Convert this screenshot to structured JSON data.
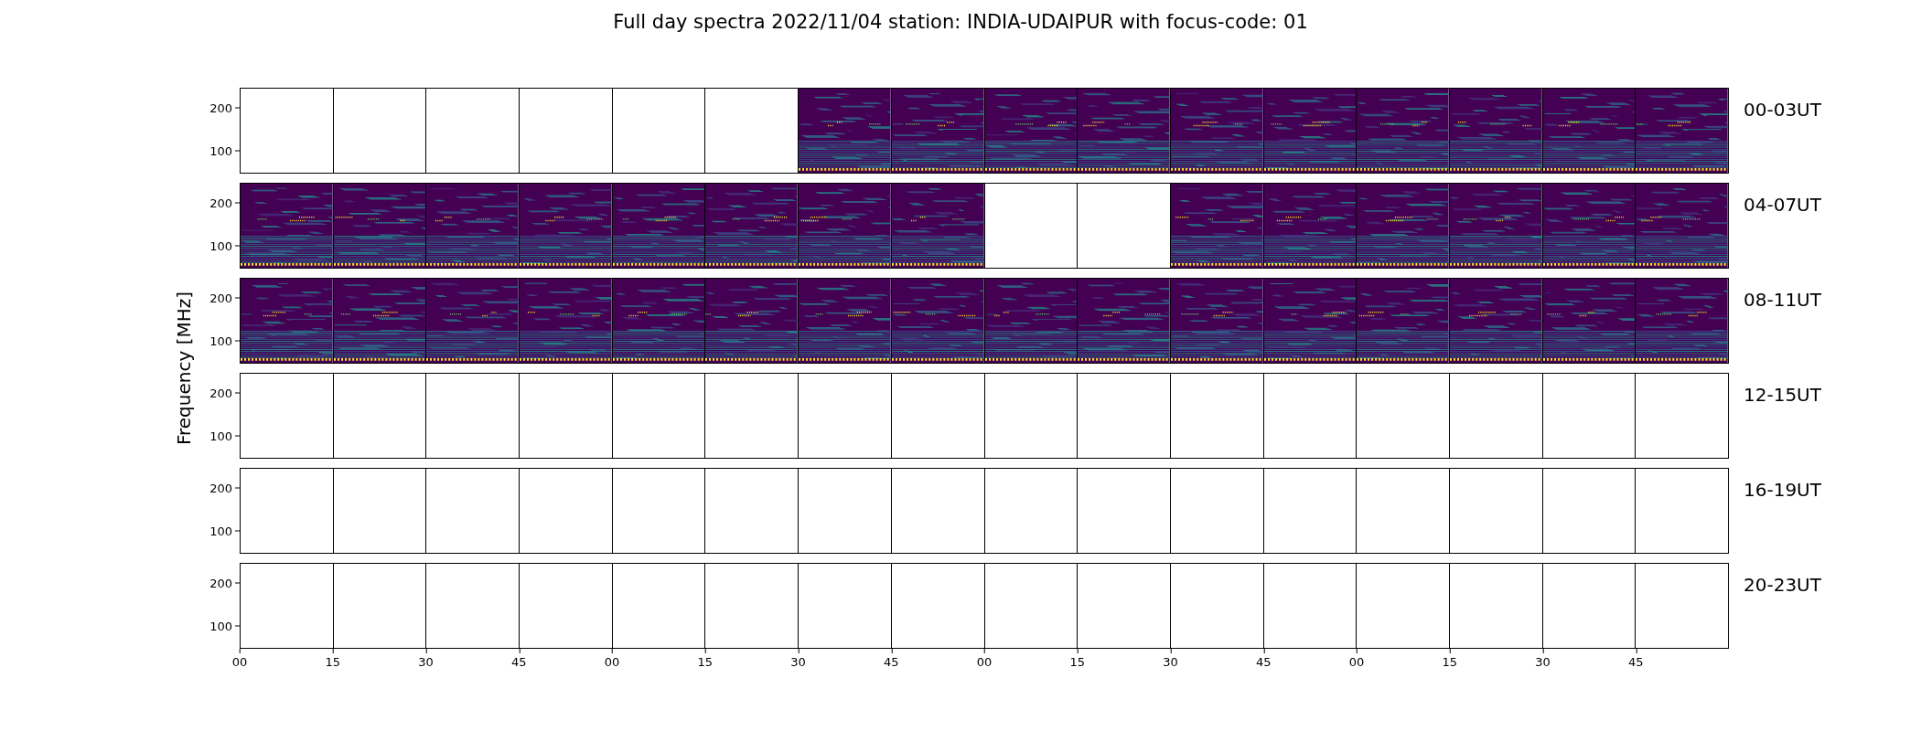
{
  "title": "Full day spectra 2022/11/04 station: INDIA-UDAIPUR with focus-code: 01",
  "ylabel": "Frequency [MHz]",
  "rows": [
    {
      "label": "00-03UT",
      "yticks": [
        "200",
        "100"
      ],
      "panels": [
        {
          "kind": "empty"
        },
        {
          "kind": "empty"
        },
        {
          "kind": "empty"
        },
        {
          "kind": "empty"
        },
        {
          "kind": "empty"
        },
        {
          "kind": "empty"
        },
        {
          "kind": "spectrum"
        },
        {
          "kind": "spectrum"
        },
        {
          "kind": "spectrum"
        },
        {
          "kind": "spectrum"
        },
        {
          "kind": "spectrum"
        },
        {
          "kind": "spectrum"
        },
        {
          "kind": "spectrum"
        },
        {
          "kind": "spectrum"
        },
        {
          "kind": "spectrum"
        },
        {
          "kind": "spectrum"
        }
      ]
    },
    {
      "label": "04-07UT",
      "yticks": [
        "200",
        "100"
      ],
      "panels": [
        {
          "kind": "spectrum"
        },
        {
          "kind": "spectrum"
        },
        {
          "kind": "spectrum"
        },
        {
          "kind": "spectrum"
        },
        {
          "kind": "spectrum"
        },
        {
          "kind": "spectrum"
        },
        {
          "kind": "spectrum"
        },
        {
          "kind": "spectrum"
        },
        {
          "kind": "empty"
        },
        {
          "kind": "empty"
        },
        {
          "kind": "spectrum"
        },
        {
          "kind": "spectrum"
        },
        {
          "kind": "spectrum"
        },
        {
          "kind": "spectrum"
        },
        {
          "kind": "spectrum"
        },
        {
          "kind": "spectrum"
        }
      ]
    },
    {
      "label": "08-11UT",
      "yticks": [
        "200",
        "100"
      ],
      "panels": [
        {
          "kind": "spectrum"
        },
        {
          "kind": "spectrum"
        },
        {
          "kind": "spectrum"
        },
        {
          "kind": "spectrum"
        },
        {
          "kind": "spectrum"
        },
        {
          "kind": "spectrum"
        },
        {
          "kind": "spectrum"
        },
        {
          "kind": "spectrum"
        },
        {
          "kind": "spectrum"
        },
        {
          "kind": "spectrum"
        },
        {
          "kind": "spectrum"
        },
        {
          "kind": "spectrum"
        },
        {
          "kind": "spectrum"
        },
        {
          "kind": "spectrum"
        },
        {
          "kind": "spectrum"
        },
        {
          "kind": "spectrum"
        }
      ]
    },
    {
      "label": "12-15UT",
      "yticks": [
        "200",
        "100"
      ],
      "panels": [
        {
          "kind": "empty"
        },
        {
          "kind": "empty"
        },
        {
          "kind": "empty"
        },
        {
          "kind": "empty"
        },
        {
          "kind": "empty"
        },
        {
          "kind": "empty"
        },
        {
          "kind": "empty"
        },
        {
          "kind": "empty"
        },
        {
          "kind": "empty"
        },
        {
          "kind": "empty"
        },
        {
          "kind": "empty"
        },
        {
          "kind": "empty"
        },
        {
          "kind": "empty"
        },
        {
          "kind": "empty"
        },
        {
          "kind": "empty"
        },
        {
          "kind": "empty"
        }
      ]
    },
    {
      "label": "16-19UT",
      "yticks": [
        "200",
        "100"
      ],
      "panels": [
        {
          "kind": "empty"
        },
        {
          "kind": "empty"
        },
        {
          "kind": "empty"
        },
        {
          "kind": "empty"
        },
        {
          "kind": "empty"
        },
        {
          "kind": "empty"
        },
        {
          "kind": "empty"
        },
        {
          "kind": "empty"
        },
        {
          "kind": "empty"
        },
        {
          "kind": "empty"
        },
        {
          "kind": "empty"
        },
        {
          "kind": "empty"
        },
        {
          "kind": "empty"
        },
        {
          "kind": "empty"
        },
        {
          "kind": "empty"
        },
        {
          "kind": "empty"
        }
      ]
    },
    {
      "label": "20-23UT",
      "yticks": [
        "200",
        "100"
      ],
      "panels": [
        {
          "kind": "empty"
        },
        {
          "kind": "empty"
        },
        {
          "kind": "empty"
        },
        {
          "kind": "empty"
        },
        {
          "kind": "empty"
        },
        {
          "kind": "empty"
        },
        {
          "kind": "empty"
        },
        {
          "kind": "empty"
        },
        {
          "kind": "empty"
        },
        {
          "kind": "empty"
        },
        {
          "kind": "empty"
        },
        {
          "kind": "empty"
        },
        {
          "kind": "empty"
        },
        {
          "kind": "empty"
        },
        {
          "kind": "empty"
        },
        {
          "kind": "empty"
        }
      ]
    }
  ],
  "xticks": [
    "00",
    "15",
    "30",
    "45",
    "00",
    "15",
    "30",
    "45",
    "00",
    "15",
    "30",
    "45",
    "00",
    "15",
    "30",
    "45"
  ]
}
